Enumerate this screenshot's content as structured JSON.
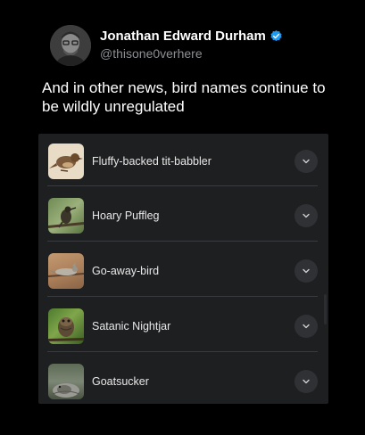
{
  "tweet": {
    "display_name": "Jonathan Edward Durham",
    "handle": "@thisone0verhere",
    "verified_icon": "verified-badge-icon",
    "verified_color": "#1d9bf0",
    "text": "And in other news, bird names continue to be wildly unregulated"
  },
  "bird_list": {
    "items": [
      {
        "label": "Fluffy-backed tit-babbler",
        "thumb_icon": "bird-illustration-thumbnail"
      },
      {
        "label": "Hoary Puffleg",
        "thumb_icon": "bird-photo-thumbnail"
      },
      {
        "label": "Go-away-bird",
        "thumb_icon": "bird-photo-thumbnail"
      },
      {
        "label": "Satanic Nightjar",
        "thumb_icon": "bird-photo-thumbnail"
      },
      {
        "label": "Goatsucker",
        "thumb_icon": "bird-photo-thumbnail"
      }
    ],
    "expand_icon": "chevron-down-icon"
  }
}
